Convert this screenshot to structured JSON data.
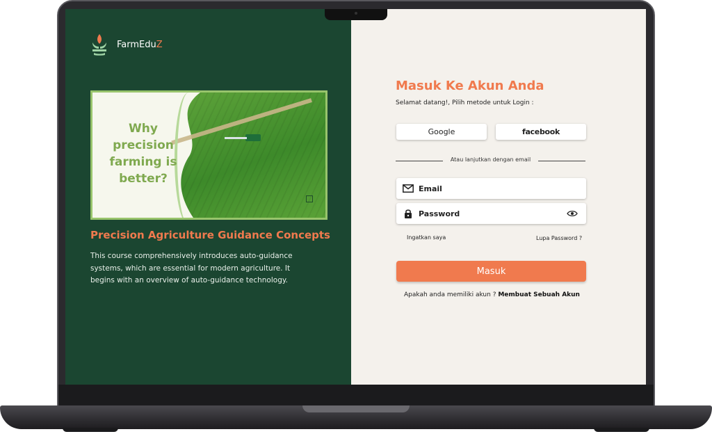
{
  "brand": {
    "name_main": "FarmEdu",
    "name_accent": "Z",
    "logo_icon": "leaf-logo-icon"
  },
  "hero": {
    "headline": "Why precision farming is better?"
  },
  "course": {
    "title": "Precision Agriculture Guidance Concepts",
    "description": "This course comprehensively introduces auto-guidance systems, which are essential for modern agriculture. It begins with an overview of auto-guidance technology."
  },
  "login": {
    "title": "Masuk Ke Akun Anda",
    "subtitle": "Selamat datang!, Pilih metode untuk Login :",
    "google_label": "Google",
    "facebook_label": "facebook",
    "divider_text": "Atau lanjutkan dengan email",
    "email_placeholder": "Email",
    "password_placeholder": "Password",
    "remember_label": "Ingatkan saya",
    "forgot_label": "Lupa Password ?",
    "submit_label": "Masuk",
    "signup_prompt": "Apakah anda memiliki akun ?",
    "signup_link": "Membuat Sebuah Akun"
  },
  "colors": {
    "left_panel_bg": "#1b4631",
    "right_panel_bg": "#f4f1ec",
    "accent": "#f07a4e",
    "hero_text": "#7fa94f"
  }
}
